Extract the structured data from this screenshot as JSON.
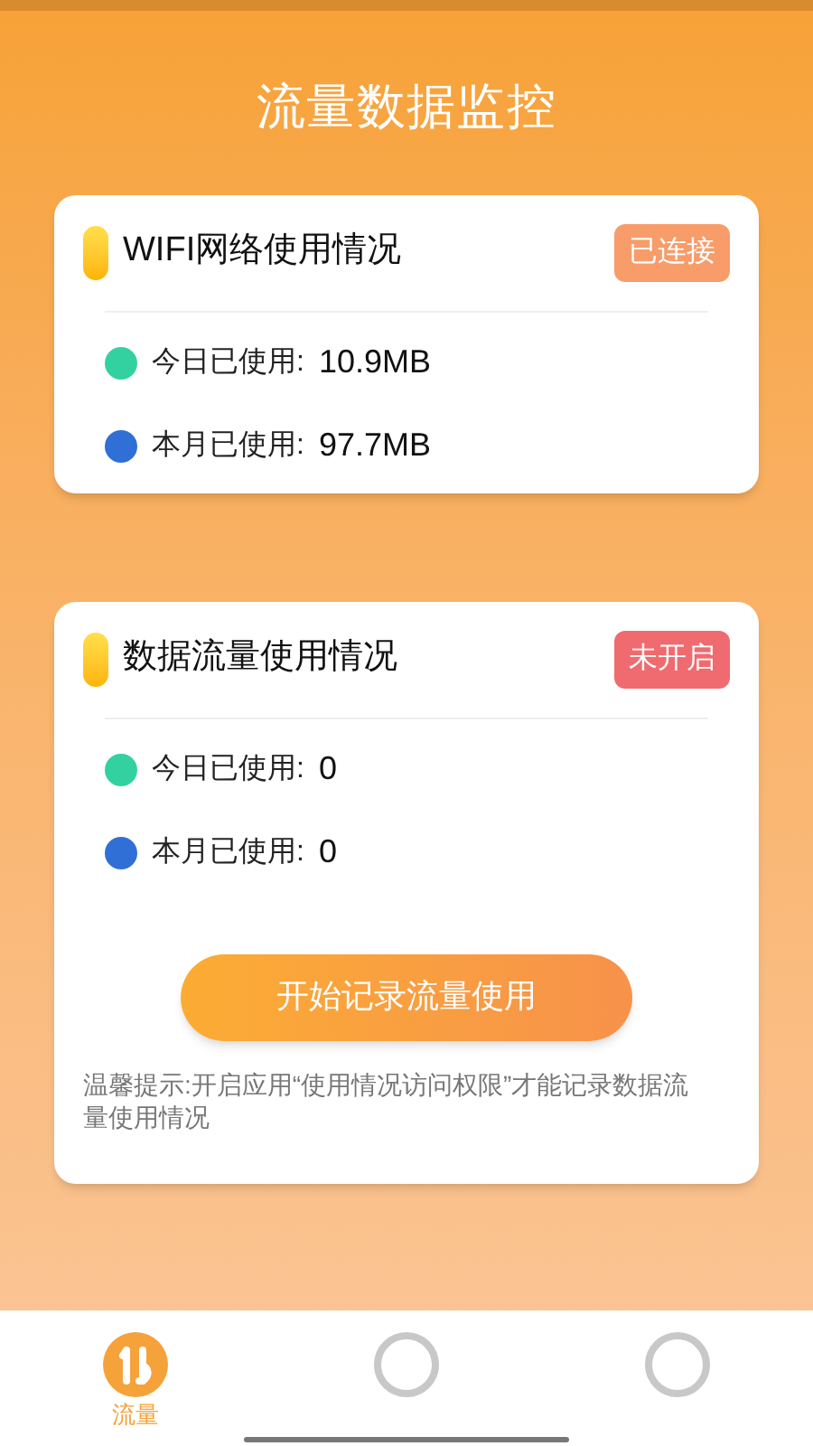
{
  "title": "流量数据监控",
  "cards": [
    {
      "title": "WIFI网络使用情况",
      "status": "已连接",
      "kind": "connected",
      "rows": [
        {
          "label": "今日已使用:",
          "value": "10.9MB",
          "color": "#34d1a0"
        },
        {
          "label": "本月已使用:",
          "value": "97.7MB",
          "color": "#2f6fd6"
        }
      ]
    },
    {
      "title": "数据流量使用情况",
      "status": "未开启",
      "kind": "off",
      "rows": [
        {
          "label": "今日已使用:",
          "value": "0",
          "color": "#34d1a0"
        },
        {
          "label": "本月已使用:",
          "value": "0",
          "color": "#2f6fd6"
        }
      ],
      "button": "开始记录流量使用",
      "tip": "温馨提示:开启应用“使用情况访问权限”才能记录数据流量使用情况"
    }
  ],
  "tabs": [
    {
      "label": "流量",
      "selected": true
    },
    {
      "selected": false
    },
    {
      "selected": false
    }
  ]
}
